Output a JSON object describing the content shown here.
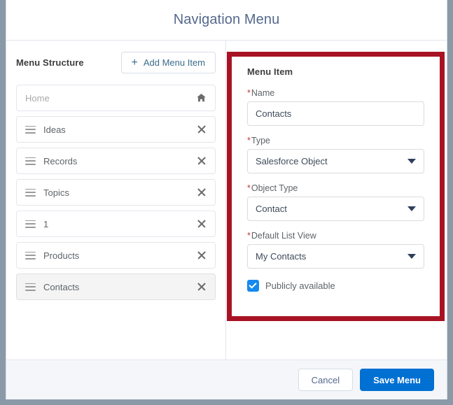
{
  "dialog": {
    "title": "Navigation Menu"
  },
  "left_panel": {
    "heading": "Menu Structure",
    "add_button_label": "Add Menu Item",
    "add_button_icon": "plus-icon",
    "items": [
      {
        "label": "Home",
        "type": "home",
        "trailing_icon": "home-icon",
        "selected": false
      },
      {
        "label": "Ideas",
        "type": "item",
        "trailing_icon": "close-icon",
        "selected": false
      },
      {
        "label": "Records",
        "type": "item",
        "trailing_icon": "close-icon",
        "selected": false
      },
      {
        "label": "Topics",
        "type": "item",
        "trailing_icon": "close-icon",
        "selected": false
      },
      {
        "label": "1",
        "type": "item",
        "trailing_icon": "close-icon",
        "selected": false
      },
      {
        "label": "Products",
        "type": "item",
        "trailing_icon": "close-icon",
        "selected": false
      },
      {
        "label": "Contacts",
        "type": "item",
        "trailing_icon": "close-icon",
        "selected": true
      }
    ]
  },
  "right_panel": {
    "heading": "Menu Item",
    "required_marker": "*",
    "fields": {
      "name": {
        "label": "Name",
        "value": "Contacts",
        "placeholder": ""
      },
      "type": {
        "label": "Type",
        "value": "Salesforce Object"
      },
      "object_type": {
        "label": "Object Type",
        "value": "Contact"
      },
      "default_list_view": {
        "label": "Default List View",
        "value": "My Contacts"
      }
    },
    "checkbox": {
      "label": "Publicly available",
      "checked": true
    }
  },
  "footer": {
    "cancel_label": "Cancel",
    "save_label": "Save Menu"
  },
  "annotation": {
    "highlight_color": "#a81324"
  },
  "colors": {
    "accent_blue": "#0070d2",
    "checkbox_blue": "#1589ee",
    "link_blue": "#3a6d8c",
    "required_red": "#c23934",
    "page_backdrop": "#8a99a8"
  }
}
